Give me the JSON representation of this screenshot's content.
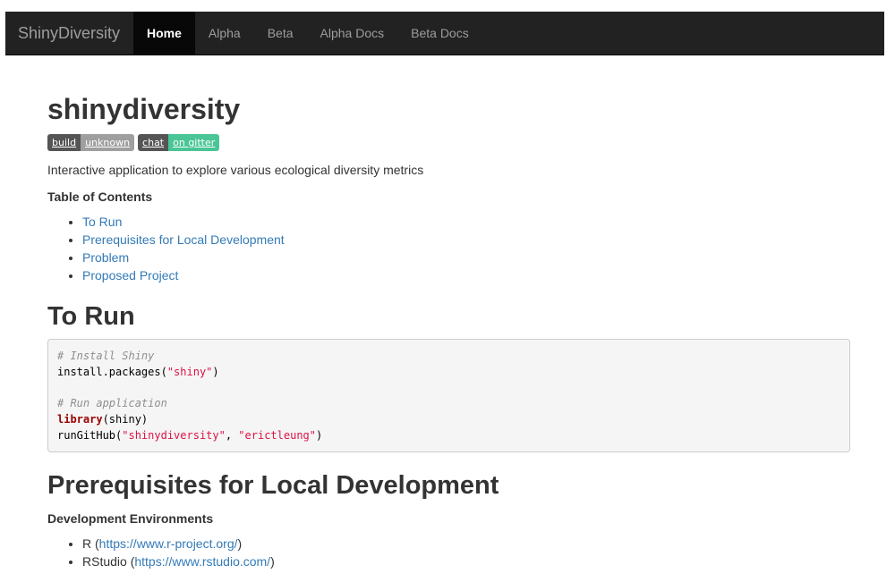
{
  "navbar": {
    "brand": "ShinyDiversity",
    "items": [
      {
        "label": "Home",
        "active": true
      },
      {
        "label": "Alpha",
        "active": false
      },
      {
        "label": "Beta",
        "active": false
      },
      {
        "label": "Alpha Docs",
        "active": false
      },
      {
        "label": "Beta Docs",
        "active": false
      }
    ]
  },
  "page": {
    "title": "shinydiversity",
    "badges": [
      {
        "left": "build",
        "right": "unknown",
        "color": "#9f9f9f"
      },
      {
        "left": "chat",
        "right": "on gitter",
        "color": "#4ac596"
      }
    ],
    "description": "Interactive application to explore various ecological diversity metrics",
    "toc_heading": "Table of Contents",
    "toc": [
      "To Run",
      "Prerequisites for Local Development",
      "Problem",
      "Proposed Project"
    ]
  },
  "to_run": {
    "heading": "To Run",
    "code": {
      "comment1": "# Install Shiny",
      "l2_fn": "install.packages(",
      "l2_str": "\"shiny\"",
      "l2_end": ")",
      "comment2": "# Run application",
      "l5_kw": "library",
      "l5_rest": "(shiny)",
      "l6_fn": "runGitHub(",
      "l6_str1": "\"shinydiversity\"",
      "l6_sep": ", ",
      "l6_str2": "\"erictleung\"",
      "l6_end": ")"
    }
  },
  "prereq": {
    "heading": "Prerequisites for Local Development",
    "subheading": "Development Environments",
    "items": [
      {
        "name": "R (",
        "link": "https://www.r-project.org/",
        "end": ")"
      },
      {
        "name": "RStudio (",
        "link": "https://www.rstudio.com/",
        "end": ")"
      }
    ]
  },
  "colors": {
    "navbar_bg": "#222222",
    "link": "#337ab7",
    "code_bg": "#f5f5f5"
  }
}
